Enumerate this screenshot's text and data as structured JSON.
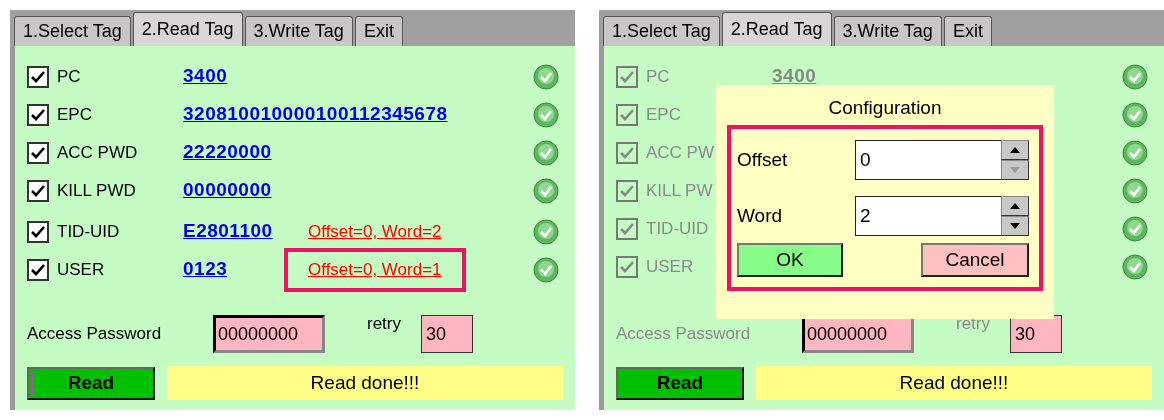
{
  "panels": [
    {
      "disabled": false,
      "tabs": [
        {
          "label": "1.Select Tag",
          "selected": false
        },
        {
          "label": "2.Read Tag",
          "selected": true
        },
        {
          "label": "3.Write Tag",
          "selected": false
        },
        {
          "label": "Exit",
          "selected": false
        }
      ],
      "rows": [
        {
          "label": "PC",
          "checked": true,
          "value": "3400"
        },
        {
          "label": "EPC",
          "checked": true,
          "value": "320810010000100112345678"
        },
        {
          "label": "ACC PWD",
          "checked": true,
          "value": "22220000"
        },
        {
          "label": "KILL PWD",
          "checked": true,
          "value": "00000000"
        },
        {
          "label": "TID-UID",
          "checked": true,
          "value": "E2801100",
          "extra": "Offset=0, Word=2",
          "highlighted": false
        },
        {
          "label": "USER",
          "checked": true,
          "value": "0123",
          "extra": "Offset=0, Word=1",
          "highlighted": true
        }
      ],
      "access": {
        "label": "Access Password",
        "value": "00000000"
      },
      "retry": {
        "label": "retry",
        "value": "30"
      },
      "read_button": {
        "label": "Read",
        "focused": true
      },
      "status_message": "Read done!!!"
    },
    {
      "disabled": true,
      "tabs": [
        {
          "label": "1.Select Tag",
          "selected": false
        },
        {
          "label": "2.Read Tag",
          "selected": true
        },
        {
          "label": "3.Write Tag",
          "selected": false
        },
        {
          "label": "Exit",
          "selected": false
        }
      ],
      "rows": [
        {
          "label": "PC",
          "checked": true,
          "value": "3400"
        },
        {
          "label": "EPC",
          "checked": true
        },
        {
          "label": "ACC PW",
          "checked": true
        },
        {
          "label": "KILL PW",
          "checked": true
        },
        {
          "label": "TID-UID",
          "checked": true
        },
        {
          "label": "USER",
          "checked": true
        }
      ],
      "access": {
        "label": "Access Password",
        "value": "00000000"
      },
      "retry": {
        "label": "retry",
        "value": "30"
      },
      "read_button": {
        "label": "Read",
        "focused": false
      },
      "status_message": "Read done!!!",
      "dialog": {
        "title": "Configuration",
        "highlighted": true,
        "fields": [
          {
            "label": "Offset",
            "value": "0",
            "down_disabled": true
          },
          {
            "label": "Word",
            "value": "2",
            "down_disabled": false
          }
        ],
        "buttons": [
          {
            "label": "OK",
            "kind": "ok"
          },
          {
            "label": "Cancel",
            "kind": "cancel"
          }
        ]
      }
    }
  ]
}
